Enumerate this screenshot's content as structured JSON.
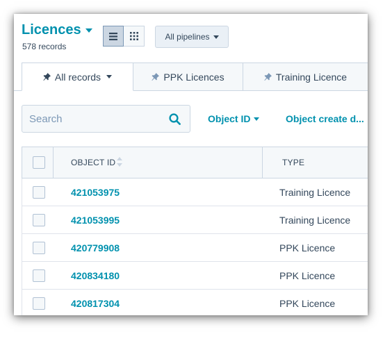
{
  "header": {
    "title": "Licences",
    "records_count": "578 records",
    "pipelines_label": "All pipelines"
  },
  "tabs": [
    {
      "label": "All records",
      "pinned": true,
      "active": true,
      "dropdown": true
    },
    {
      "label": "PPK Licences",
      "pinned": true,
      "active": false
    },
    {
      "label": "Training Licence",
      "pinned": true,
      "active": false
    }
  ],
  "search": {
    "placeholder": "Search",
    "value": ""
  },
  "filters": {
    "object_id": "Object ID",
    "object_create_date": "Object create d..."
  },
  "table": {
    "columns": [
      "OBJECT ID",
      "TYPE"
    ],
    "rows": [
      {
        "object_id": "421053975",
        "type": "Training Licence"
      },
      {
        "object_id": "421053995",
        "type": "Training Licence"
      },
      {
        "object_id": "420779908",
        "type": "PPK Licence"
      },
      {
        "object_id": "420834180",
        "type": "PPK Licence"
      },
      {
        "object_id": "420817304",
        "type": "PPK Licence"
      }
    ]
  },
  "colors": {
    "accent": "#0091ae",
    "text": "#33475b",
    "border": "#cbd6e2",
    "muted_bg": "#f5f8fa"
  }
}
